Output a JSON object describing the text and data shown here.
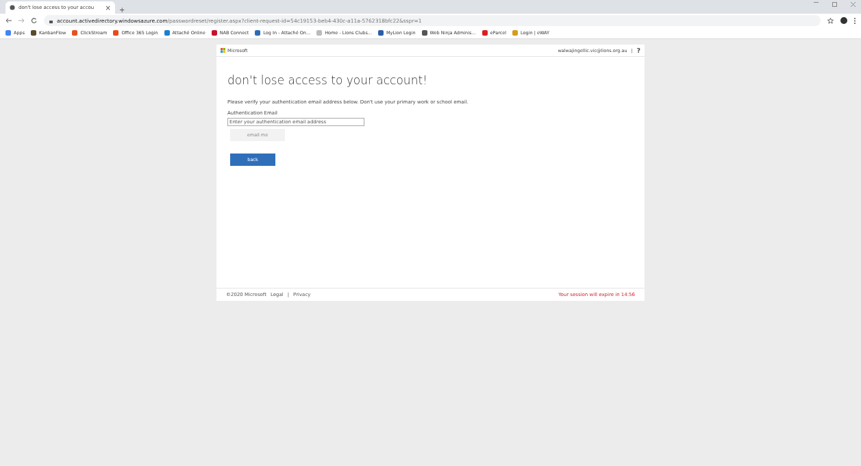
{
  "browser": {
    "tab": {
      "title": "don't lose access to your accou",
      "close": "×"
    },
    "new_tab": "+",
    "url_host": "account.activedirectory.windowsazure.com",
    "url_path": "/passwordreset/register.aspx?client-request-id=54c19153-beb4-430c-a11a-5762318bfc22&sspr=1",
    "bookmarks": [
      {
        "label": "Apps",
        "color": "#4285f4"
      },
      {
        "label": "KanbanFlow",
        "color": "#5a4a2a"
      },
      {
        "label": "ClickStream",
        "color": "#e8501e"
      },
      {
        "label": "Office 365 Login",
        "color": "#e84a1b"
      },
      {
        "label": "Attaché Online",
        "color": "#1a7fd0"
      },
      {
        "label": "NAB Connect",
        "color": "#c8102e"
      },
      {
        "label": "Log In - Attaché On...",
        "color": "#2a6db5"
      },
      {
        "label": "Home - Lions Clubs...",
        "color": "#bbbbbb"
      },
      {
        "label": "MyLion Login",
        "color": "#2a5ea8"
      },
      {
        "label": "Web Ninja Adminis...",
        "color": "#555555"
      },
      {
        "label": "eParcel",
        "color": "#dc1e23"
      },
      {
        "label": "Login | eWAY",
        "color": "#d89a1a"
      }
    ]
  },
  "header": {
    "brand": "Microsoft",
    "user": "walwajingellic.vic@lions.org.au",
    "separator": "|",
    "help": "?"
  },
  "title": "don't lose access to your account!",
  "instructions": "Please verify your authentication email address below. Don't use your primary work or school email.",
  "field": {
    "label": "Authentication Email",
    "placeholder": "Enter your authentication email address"
  },
  "buttons": [
    {
      "label": "email me",
      "disabled": true
    },
    {
      "label": "back",
      "disabled": false
    }
  ],
  "footer": {
    "copyright": "©2020 Microsoft",
    "links": [
      "Legal",
      "Privacy"
    ],
    "separator": "|",
    "session": "Your session will expire in 14:56"
  }
}
